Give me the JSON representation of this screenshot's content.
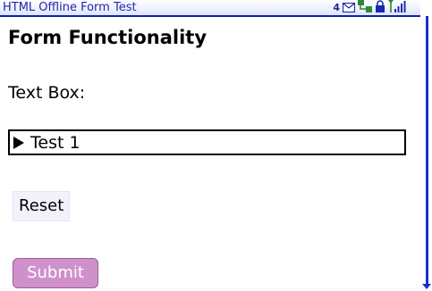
{
  "window": {
    "title": "HTML Offline Form Test"
  },
  "status_bar": {
    "battery_count": "4",
    "icons": [
      "message-envelope-icon",
      "network-icon",
      "lock-icon",
      "signal-antenna-icon"
    ]
  },
  "main": {
    "heading": "Form Functionality",
    "text_box_label": "Text Box:",
    "text_box_value": "Test 1",
    "reset_label": "Reset",
    "submit_label": "Submit"
  },
  "colors": {
    "title_text": "#1d2aa8",
    "title_border": "#0f1fb0",
    "scrollbar": "#1b2fc8",
    "submit_bg": "#cf91cb",
    "reset_bg": "#f3f2fa"
  }
}
